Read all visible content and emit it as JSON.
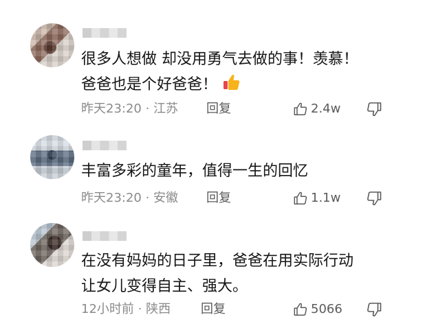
{
  "comments": [
    {
      "avatar_icon": "user-avatar-blurred",
      "lines": [
        "很多人想做 却没用勇气去做的事！羡慕！",
        "爸爸也是个好爸爸！"
      ],
      "emoji": "thumbs-up-emoji",
      "time": "昨天23:20",
      "location": "江苏",
      "reply_label": "回复",
      "likes": "2.4w"
    },
    {
      "avatar_icon": "user-avatar-blurred",
      "lines": [
        "丰富多彩的童年，值得一生的回忆"
      ],
      "time": "昨天23:20",
      "location": "安徽",
      "reply_label": "回复",
      "likes": "1.1w"
    },
    {
      "avatar_icon": "user-avatar-blurred",
      "lines": [
        "在没有妈妈的日子里，爸爸在用实际行动",
        "让女儿变得自主、强大。"
      ],
      "time": "12小时前",
      "location": "陕西",
      "reply_label": "回复",
      "likes": "5066"
    }
  ],
  "meta_separator": " · ",
  "colors": {
    "meta": "#8a8a8a",
    "text": "#151515",
    "icon": "#5a5a5a"
  }
}
